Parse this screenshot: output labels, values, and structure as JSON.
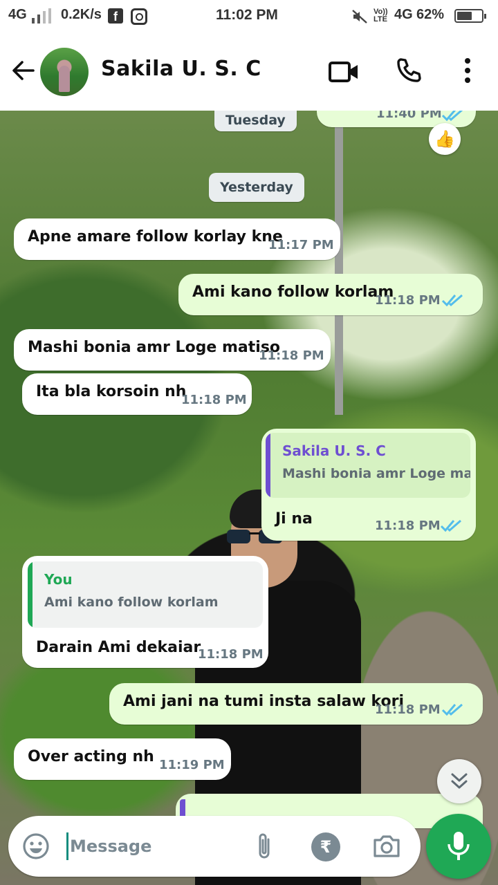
{
  "status_bar": {
    "network": "4G",
    "speed": "0.2K/s",
    "time": "11:02 PM",
    "volte": "Vo)) LTE",
    "network2": "4G",
    "battery_percent": "62%",
    "battery_level": 0.62
  },
  "header": {
    "contact_name": "Sakila U. S. C"
  },
  "chat": {
    "date_chips": [
      "Tuesday",
      "Yesterday"
    ],
    "partial_top_time": "11:40 PM",
    "reaction_emoji": "👍",
    "messages": [
      {
        "direction": "in",
        "text": "Apne amare follow korlay kne",
        "time": "11:17 PM"
      },
      {
        "direction": "out",
        "text": "Ami kano follow korlam",
        "time": "11:18 PM",
        "status": "read"
      },
      {
        "direction": "in",
        "text": "Mashi bonia amr Loge matiso",
        "time": "11:18 PM"
      },
      {
        "direction": "in",
        "text": "Ita bla korsoin nh",
        "time": "11:18 PM"
      },
      {
        "direction": "out",
        "text": "Ji na",
        "time": "11:18 PM",
        "status": "read",
        "quote": {
          "name": "Sakila U. S. C",
          "text": "Mashi bonia amr Loge matiso"
        }
      },
      {
        "direction": "in",
        "text": "Darain Ami dekaiar",
        "time": "11:18 PM",
        "quote": {
          "name": "You",
          "text": "Ami kano follow korlam"
        }
      },
      {
        "direction": "out",
        "text": "Ami jani na tumi insta salaw kori",
        "time": "11:18 PM",
        "status": "read"
      },
      {
        "direction": "in",
        "text": "Over acting nh",
        "time": "11:19 PM"
      }
    ]
  },
  "composer": {
    "placeholder": "Message",
    "rupee_symbol": "₹"
  },
  "colors": {
    "outgoing_bubble": "#e7fdd6",
    "incoming_bubble": "#ffffff",
    "read_ticks": "#53bdeb",
    "mic_button": "#1fa855",
    "quote_bar_contact": "#6e4fd1",
    "quote_bar_you": "#1fa855"
  }
}
